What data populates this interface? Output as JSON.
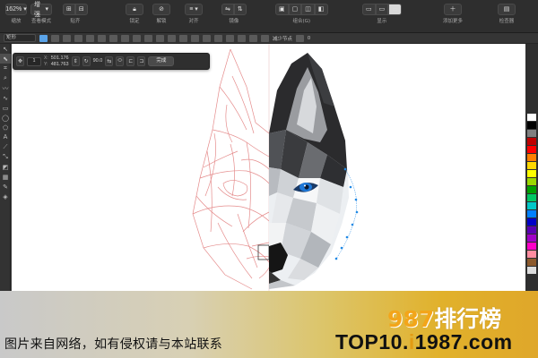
{
  "toolbar": {
    "zoom": "162%",
    "view_mode": "增强",
    "labels": [
      "查看模式",
      "对齐辅助线",
      "锁定",
      "解锁",
      "对齐",
      "镜像",
      "组合",
      "组合(G)",
      "显示",
      "贴齐",
      "调整",
      "添加更多...",
      "检查器"
    ],
    "label_zoom": "缩放",
    "label_view": "查看模式",
    "label_snap": "贴齐",
    "label_lock": "锁定",
    "label_unlock": "解锁",
    "label_align": "对齐",
    "label_mirror": "镜像",
    "label_group": "组合(G)",
    "label_view_right": "显示",
    "label_add_more": "添加更多",
    "label_inspector": "检查器"
  },
  "propbar": {
    "mode": "矩形",
    "reduce_nodes": "减少节点",
    "smooth_value": "0"
  },
  "float_panel": {
    "node_count": "1",
    "x_label": "X:",
    "y_label": "Y:",
    "x_value": "501.176",
    "y_value": "481.763",
    "angle": "90.0",
    "done_label": "完成"
  },
  "palette_colors": [
    "#ffffff",
    "#000000",
    "#7f7f7f",
    "#c00000",
    "#ff0000",
    "#ff7f00",
    "#ffd800",
    "#ffff00",
    "#9bd800",
    "#00a000",
    "#00c864",
    "#00c8c8",
    "#0080ff",
    "#0000c8",
    "#5a00b4",
    "#a000c8",
    "#ff00c8",
    "#ff8ca0",
    "#8c5a2d",
    "#dcdcdc"
  ],
  "banner": {
    "caption": "图片来自网络，如有侵权请与本站联系",
    "brand_number": "987",
    "brand_text": "排行榜",
    "logo_text": "TOP10.",
    "logo_mid": "i",
    "logo_end": "1987.com"
  }
}
